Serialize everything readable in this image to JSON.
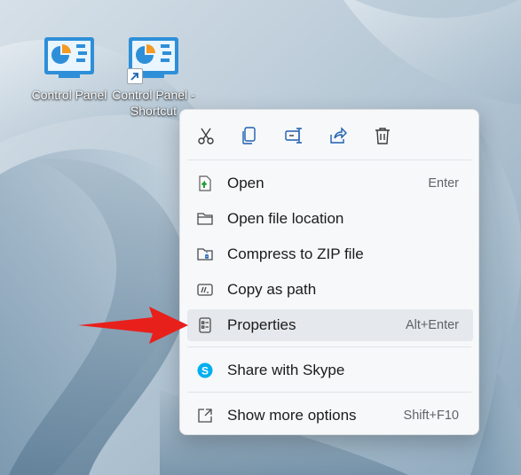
{
  "desktop": {
    "icons": [
      {
        "label": "Control Panel"
      },
      {
        "label": "Control Panel - Shortcut"
      }
    ]
  },
  "menu": {
    "toolbar": [
      {
        "icon": "cut-icon"
      },
      {
        "icon": "copy-icon"
      },
      {
        "icon": "rename-icon"
      },
      {
        "icon": "share-icon"
      },
      {
        "icon": "delete-icon"
      }
    ],
    "items": [
      {
        "label": "Open",
        "shortcut": "Enter",
        "icon": "open-icon"
      },
      {
        "label": "Open file location",
        "shortcut": "",
        "icon": "folder-icon"
      },
      {
        "label": "Compress to ZIP file",
        "shortcut": "",
        "icon": "zip-icon"
      },
      {
        "label": "Copy as path",
        "shortcut": "",
        "icon": "copy-path-icon"
      },
      {
        "label": "Properties",
        "shortcut": "Alt+Enter",
        "icon": "properties-icon",
        "highlighted": true
      },
      {
        "label": "Share with Skype",
        "shortcut": "",
        "icon": "skype-icon"
      },
      {
        "label": "Show more options",
        "shortcut": "Shift+F10",
        "icon": "more-options-icon"
      }
    ]
  },
  "colors": {
    "accent": "#0067c0",
    "annotation_arrow": "#e8201c",
    "skype": "#00aff0",
    "menu_bg": "#f6f8fa",
    "highlight": "#e5e8ec"
  }
}
